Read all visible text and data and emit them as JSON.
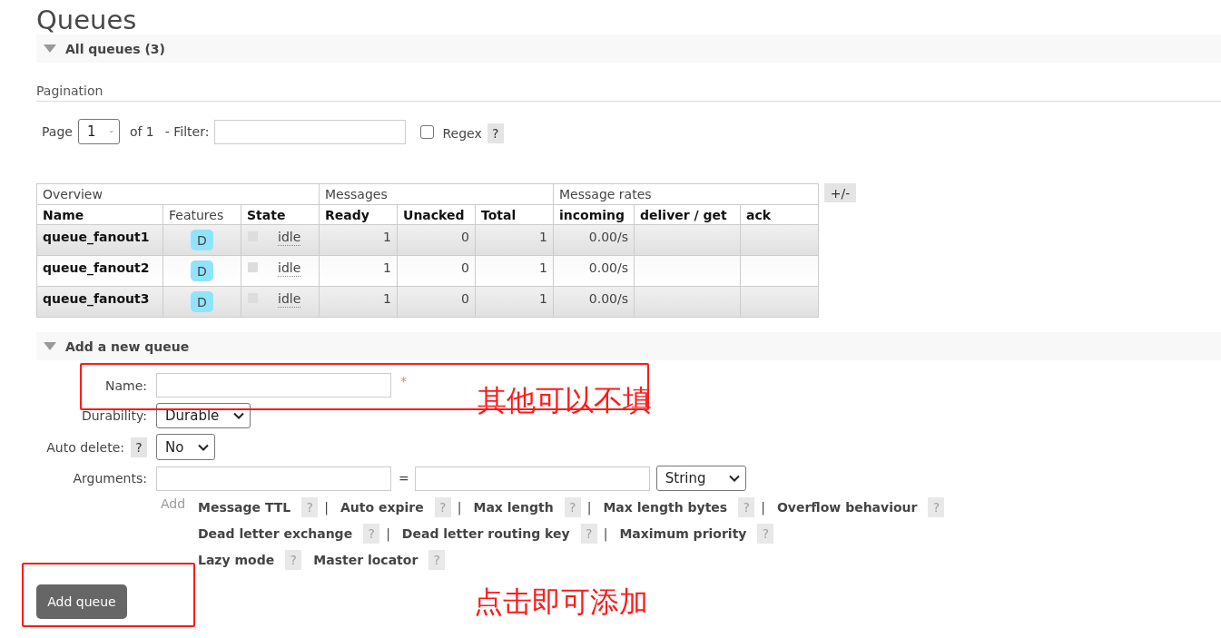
{
  "page": {
    "title": "Queues"
  },
  "all_queues": {
    "heading": "All queues (3)",
    "expanded": true
  },
  "pagination": {
    "label": "Pagination",
    "page_label": "Page",
    "page_value": "1",
    "of_label": "of 1",
    "filter_label": "- Filter:",
    "regex": {
      "label": "Regex",
      "checked": false,
      "help": "?"
    }
  },
  "table": {
    "groups": [
      {
        "label": "Overview",
        "columns": [
          {
            "label": "Name",
            "sortable": true
          },
          {
            "label": "Features",
            "sortable": false
          },
          {
            "label": "State",
            "sortable": true
          }
        ]
      },
      {
        "label": "Messages",
        "columns": [
          {
            "label": "Ready",
            "sortable": true
          },
          {
            "label": "Unacked",
            "sortable": true
          },
          {
            "label": "Total",
            "sortable": true
          }
        ]
      },
      {
        "label": "Message rates",
        "columns": [
          {
            "label": "incoming",
            "sortable": true
          },
          {
            "label": "deliver / get",
            "sortable": true
          },
          {
            "label": "ack",
            "sortable": true
          }
        ]
      }
    ],
    "columns_toggle": "+/-",
    "rows": [
      {
        "name": "queue_fanout1",
        "features": [
          "D"
        ],
        "state": "idle",
        "figures": [
          "1",
          "0",
          "1",
          "0.00/s"
        ]
      },
      {
        "name": "queue_fanout2",
        "features": [
          "D"
        ],
        "state": "idle",
        "figures": [
          "1",
          "0",
          "1",
          "0.00/s"
        ]
      },
      {
        "name": "queue_fanout3",
        "features": [
          "D"
        ],
        "state": "idle",
        "figures": [
          "1",
          "0",
          "1",
          "0.00/s"
        ]
      }
    ]
  },
  "add_queue": {
    "heading": "Add a new queue",
    "expanded": true,
    "fields": [
      {
        "kind": "text",
        "label": "Name:",
        "required_mark": "*"
      },
      {
        "kind": "select",
        "label": "Durability:",
        "value": "Durable"
      },
      {
        "kind": "select",
        "label": "Auto delete:",
        "help": "?",
        "value": "No"
      },
      {
        "kind": "arguments",
        "label": "Arguments:",
        "separator": "=",
        "type_value": "String"
      }
    ],
    "add_label": "Add",
    "hint_lines": [
      {
        "items": [
          {
            "label": "Message TTL",
            "help": "?",
            "separator": "|"
          },
          {
            "label": "Auto expire",
            "help": "?",
            "separator": "|"
          },
          {
            "label": "Max length",
            "help": "?",
            "separator": "|"
          },
          {
            "label": "Max length bytes",
            "help": "?",
            "separator": "|"
          },
          {
            "label": "Overflow behaviour",
            "help": "?"
          }
        ]
      },
      {
        "items": [
          {
            "label": "Dead letter exchange",
            "help": "?",
            "separator": "|"
          },
          {
            "label": "Dead letter routing key",
            "help": "?",
            "separator": "|"
          },
          {
            "label": "Maximum priority",
            "help": "?"
          }
        ]
      },
      {
        "items": [
          {
            "label": "Lazy mode",
            "help": "?"
          },
          {
            "label": "Master locator",
            "help": "?"
          }
        ]
      }
    ],
    "submit": "Add queue"
  },
  "annotations": [
    {
      "text": "其他可以不填"
    },
    {
      "text": "点击即可添加"
    }
  ]
}
